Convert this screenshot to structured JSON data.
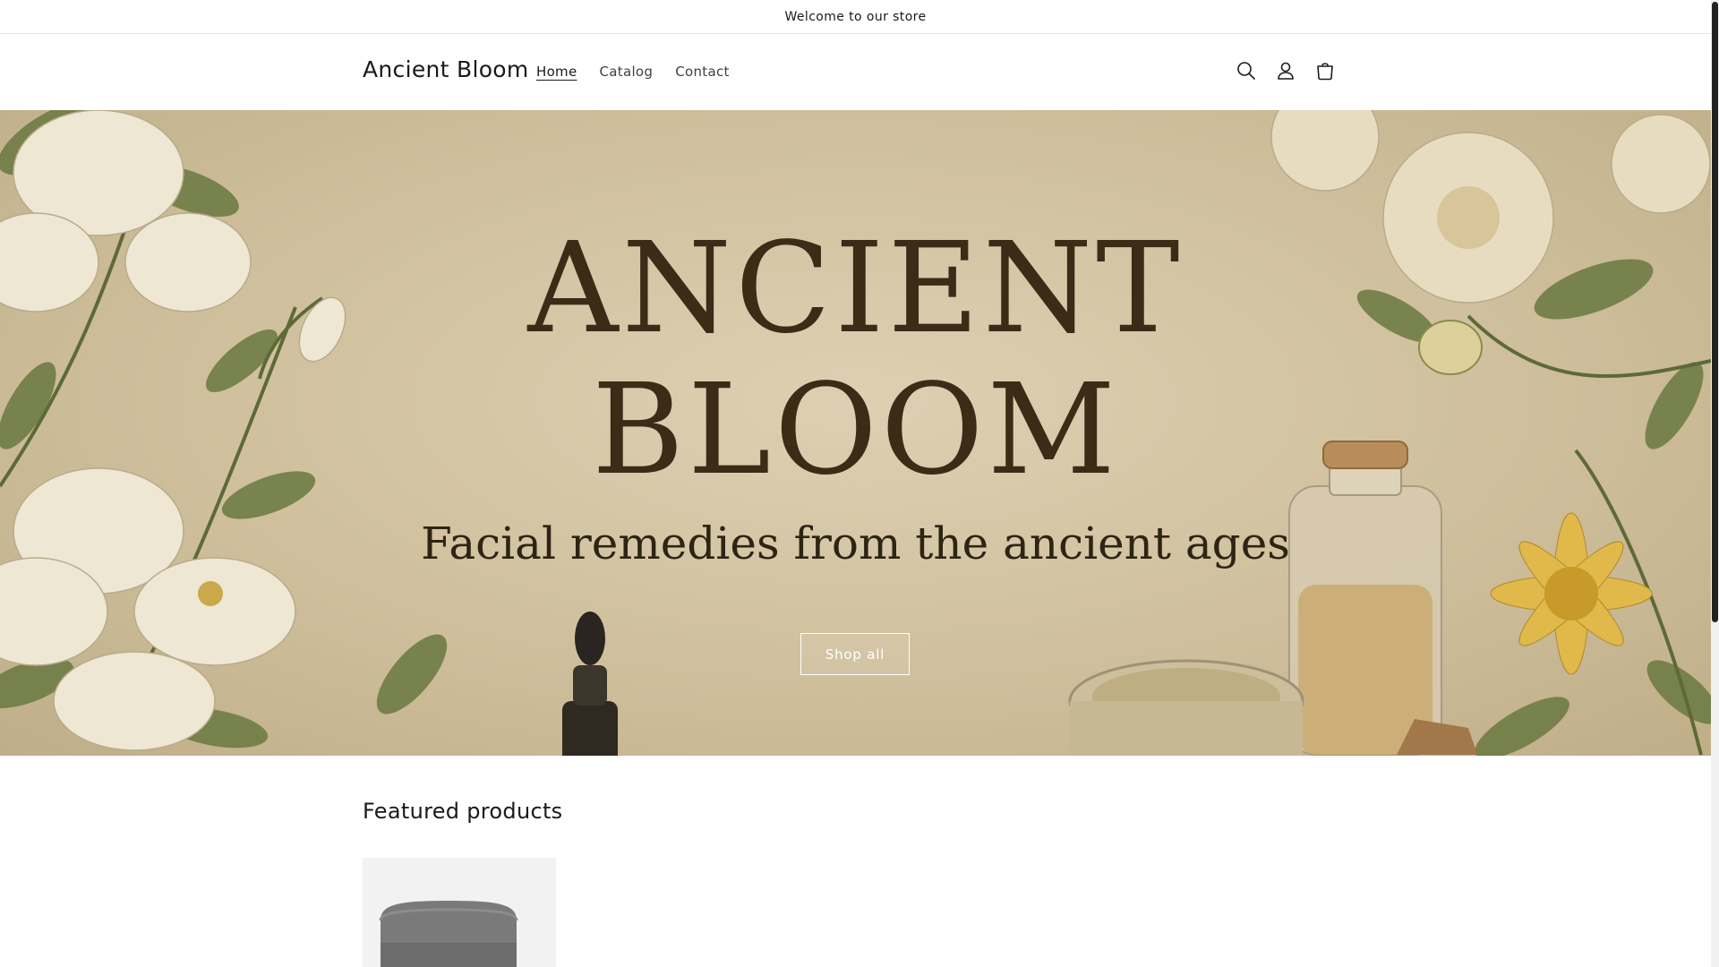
{
  "announcement": {
    "text": "Welcome to our store"
  },
  "header": {
    "logo": "Ancient Bloom",
    "nav": [
      {
        "label": "Home",
        "active": true
      },
      {
        "label": "Catalog",
        "active": false
      },
      {
        "label": "Contact",
        "active": false
      }
    ],
    "icons": [
      "search-icon",
      "account-icon",
      "cart-icon"
    ]
  },
  "hero": {
    "title_line1": "ANCIENT",
    "title_line2": "BLOOM",
    "subtitle": "Facial remedies from the ancient ages",
    "button_label": "Shop all"
  },
  "featured": {
    "title": "Featured products"
  },
  "colors": {
    "accent_text": "#121212",
    "hero_bg": "#cfbf9c",
    "hero_title": "#3a2c17"
  }
}
